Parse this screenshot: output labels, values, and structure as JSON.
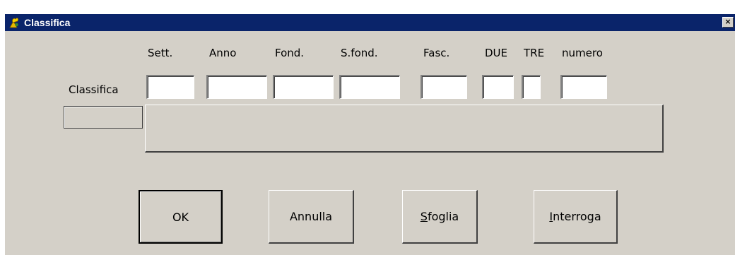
{
  "window": {
    "title": "Classifica",
    "close_glyph": "×",
    "icon": "classifica-app-icon"
  },
  "form": {
    "columns": {
      "sett": "Sett.",
      "anno": "Anno",
      "fond": "Fond.",
      "sfond": "S.fond.",
      "fasc": "Fasc.",
      "due": "DUE",
      "tre": "TRE",
      "numero": "numero"
    },
    "row_label": "Classifica",
    "values": {
      "sett": "",
      "anno": "",
      "fond": "",
      "sfond": "",
      "fasc": "",
      "due": "",
      "tre": "",
      "numero": ""
    },
    "description": ""
  },
  "buttons": {
    "ok": "OK",
    "annulla": "Annulla",
    "sfoglia_mnemonic": "S",
    "sfoglia_rest": "foglia",
    "interroga_mnemonic": "I",
    "interroga_rest": "nterroga"
  },
  "colors": {
    "titlebar": "#0a246a",
    "face": "#d4d0c8"
  }
}
